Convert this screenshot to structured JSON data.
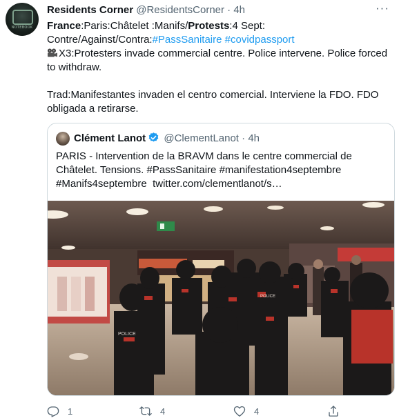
{
  "author": {
    "name": "Residents Corner",
    "handle": "@ResidentsCorner",
    "dot": "·",
    "time": "4h",
    "avatar_caption": "NOTEBOOK"
  },
  "more_icon": "more-horizontal-icon",
  "tweet": {
    "france": "France",
    "seg1": ":Paris:Châtelet :Manifs/",
    "protests": "Protests",
    "seg2": ":4 Sept:",
    "line2_text": "Contre/Against/Contra:",
    "hashtag1": "#PassSanitaire",
    "hashtag2": "#covidpassport",
    "line3": "X3:Protesters invade commercial centre. Police intervene. Police forced to withdraw.",
    "line4": "Trad:Manifestantes invaden el centro comercial. Interviene la FDO. FDO obligada a retirarse."
  },
  "quoted": {
    "name": "Clément Lanot",
    "handle": "@ClementLanot",
    "dot": "·",
    "time": "4h",
    "text_line1": "PARIS - Intervention de la BRAVM dans le centre commercial de",
    "text_line2_a": "Châtelet. Tensions. ",
    "tag1": "#PassSanitaire",
    "tag2": "#manifestation4septembre",
    "tag3": "#Manifs4septembre",
    "link": "twitter.com/clementlanot/s…"
  },
  "media": {
    "jacket_text": "POLICE"
  },
  "actions": {
    "reply_count": "1",
    "retweet_count": "4",
    "like_count": "4"
  },
  "colors": {
    "link": "#1d9bf0",
    "muted": "#536471",
    "text": "#0f1419",
    "border": "#cfd9de",
    "verified": "#1d9bf0"
  }
}
